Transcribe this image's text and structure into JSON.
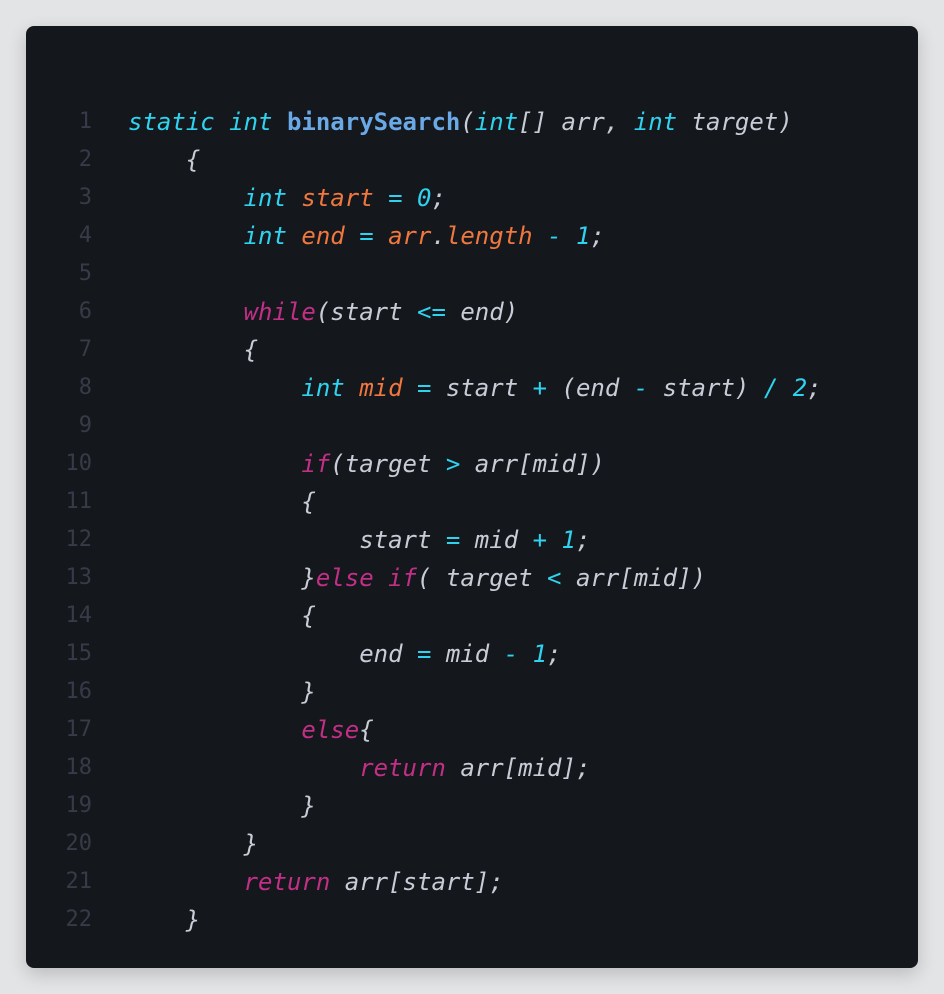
{
  "editor": {
    "lines": [
      {
        "n": "1",
        "tokens": [
          [
            "static ",
            "type"
          ],
          [
            "int ",
            "type"
          ],
          [
            "binarySearch",
            "func"
          ],
          [
            "(",
            "punct"
          ],
          [
            "int",
            "type"
          ],
          [
            "[] arr, ",
            "plain"
          ],
          [
            "int ",
            "type"
          ],
          [
            "target)",
            "plain"
          ]
        ]
      },
      {
        "n": "2",
        "tokens": [
          [
            "    {",
            "punct"
          ]
        ]
      },
      {
        "n": "3",
        "tokens": [
          [
            "        ",
            "plain"
          ],
          [
            "int ",
            "type"
          ],
          [
            "start ",
            "var"
          ],
          [
            "= ",
            "op"
          ],
          [
            "0",
            "num"
          ],
          [
            ";",
            "punct"
          ]
        ]
      },
      {
        "n": "4",
        "tokens": [
          [
            "        ",
            "plain"
          ],
          [
            "int ",
            "type"
          ],
          [
            "end ",
            "var"
          ],
          [
            "= ",
            "op"
          ],
          [
            "arr",
            "var"
          ],
          [
            ".",
            "punct"
          ],
          [
            "length ",
            "prop"
          ],
          [
            "- ",
            "op"
          ],
          [
            "1",
            "num"
          ],
          [
            ";",
            "punct"
          ]
        ]
      },
      {
        "n": "5",
        "tokens": []
      },
      {
        "n": "6",
        "tokens": [
          [
            "        ",
            "plain"
          ],
          [
            "while",
            "keyword"
          ],
          [
            "(start ",
            "plain"
          ],
          [
            "<= ",
            "op"
          ],
          [
            "end)",
            "plain"
          ]
        ]
      },
      {
        "n": "7",
        "tokens": [
          [
            "        {",
            "punct"
          ]
        ]
      },
      {
        "n": "8",
        "tokens": [
          [
            "            ",
            "plain"
          ],
          [
            "int ",
            "type"
          ],
          [
            "mid ",
            "var"
          ],
          [
            "= ",
            "op"
          ],
          [
            "start ",
            "plain"
          ],
          [
            "+ ",
            "op"
          ],
          [
            "(end ",
            "plain"
          ],
          [
            "- ",
            "op"
          ],
          [
            "start) ",
            "plain"
          ],
          [
            "/ ",
            "op"
          ],
          [
            "2",
            "num"
          ],
          [
            ";",
            "punct"
          ]
        ]
      },
      {
        "n": "9",
        "tokens": []
      },
      {
        "n": "10",
        "tokens": [
          [
            "            ",
            "plain"
          ],
          [
            "if",
            "keyword"
          ],
          [
            "(target ",
            "plain"
          ],
          [
            "> ",
            "op"
          ],
          [
            "arr[mid])",
            "plain"
          ]
        ]
      },
      {
        "n": "11",
        "tokens": [
          [
            "            {",
            "punct"
          ]
        ]
      },
      {
        "n": "12",
        "tokens": [
          [
            "                start ",
            "plain"
          ],
          [
            "= ",
            "op"
          ],
          [
            "mid ",
            "plain"
          ],
          [
            "+ ",
            "op"
          ],
          [
            "1",
            "num"
          ],
          [
            ";",
            "punct"
          ]
        ]
      },
      {
        "n": "13",
        "tokens": [
          [
            "            }",
            "punct"
          ],
          [
            "else ",
            "keyword"
          ],
          [
            "if",
            "keyword"
          ],
          [
            "( target ",
            "plain"
          ],
          [
            "< ",
            "op"
          ],
          [
            "arr[mid])",
            "plain"
          ]
        ]
      },
      {
        "n": "14",
        "tokens": [
          [
            "            {",
            "punct"
          ]
        ]
      },
      {
        "n": "15",
        "tokens": [
          [
            "                end ",
            "plain"
          ],
          [
            "= ",
            "op"
          ],
          [
            "mid ",
            "plain"
          ],
          [
            "- ",
            "op"
          ],
          [
            "1",
            "num"
          ],
          [
            ";",
            "punct"
          ]
        ]
      },
      {
        "n": "16",
        "tokens": [
          [
            "            }",
            "punct"
          ]
        ]
      },
      {
        "n": "17",
        "tokens": [
          [
            "            ",
            "plain"
          ],
          [
            "else",
            "keyword"
          ],
          [
            "{",
            "punct"
          ]
        ]
      },
      {
        "n": "18",
        "tokens": [
          [
            "                ",
            "plain"
          ],
          [
            "return ",
            "keyword"
          ],
          [
            "arr[mid];",
            "plain"
          ]
        ]
      },
      {
        "n": "19",
        "tokens": [
          [
            "            }",
            "punct"
          ]
        ]
      },
      {
        "n": "20",
        "tokens": [
          [
            "        }",
            "punct"
          ]
        ]
      },
      {
        "n": "21",
        "tokens": [
          [
            "        ",
            "plain"
          ],
          [
            "return ",
            "keyword"
          ],
          [
            "arr[start];",
            "plain"
          ]
        ]
      },
      {
        "n": "22",
        "tokens": [
          [
            "    }",
            "punct"
          ]
        ]
      }
    ]
  },
  "colors": {
    "background": "#14171c",
    "line_number": "#363b47",
    "type": "#2fd3f0",
    "keyword": "#c22f86",
    "function": "#6aa8e6",
    "variable": "#f0773e",
    "plain": "#c8ccd6"
  }
}
